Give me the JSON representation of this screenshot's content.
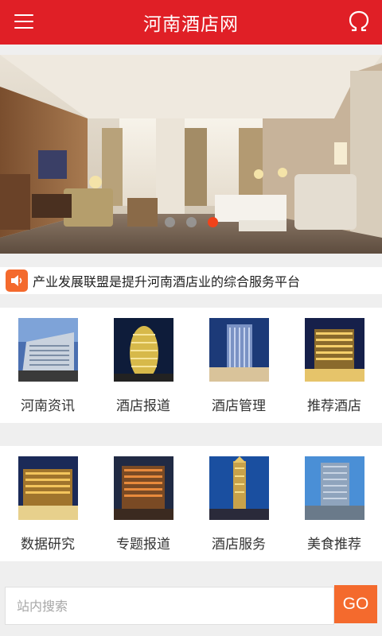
{
  "header": {
    "title": "河南酒店网",
    "menu_icon": "menu-icon",
    "user_icon": "omega-user-icon",
    "background": "#e01f26"
  },
  "banner": {
    "slide_count": 3,
    "active_index": 2,
    "active_color": "#f0431b"
  },
  "notice": {
    "icon": "speaker-icon",
    "text": "产业发展联盟是提升河南酒店业的综合服务平台"
  },
  "nav_row_1": [
    {
      "label": "河南资讯",
      "icon": "hotel-building-photo"
    },
    {
      "label": "酒店报道",
      "icon": "hotel-tower-photo"
    },
    {
      "label": "酒店管理",
      "icon": "hotel-skyscraper-photo"
    },
    {
      "label": "推荐酒店",
      "icon": "hotel-night-photo"
    }
  ],
  "nav_row_2": [
    {
      "label": "数据研究",
      "icon": "hotel-lit-photo"
    },
    {
      "label": "专题报道",
      "icon": "hotel-dusk-photo"
    },
    {
      "label": "酒店服务",
      "icon": "hotel-tower-night-photo"
    },
    {
      "label": "美食推荐",
      "icon": "hotel-complex-photo"
    }
  ],
  "search": {
    "placeholder": "站内搜索",
    "value": "",
    "button_label": "GO",
    "button_color": "#f46a2d"
  }
}
